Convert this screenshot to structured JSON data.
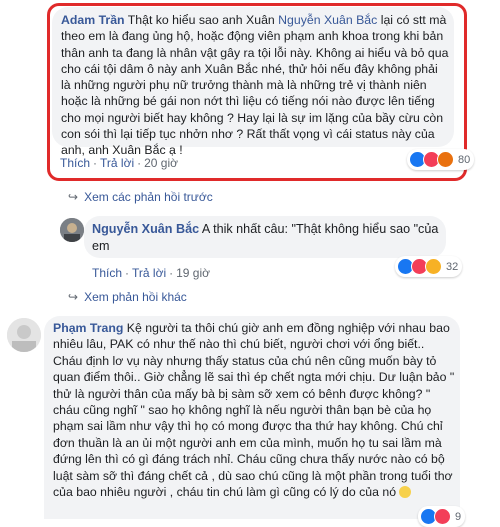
{
  "comment1": {
    "author": "Adam Trần",
    "text_before": " Thật ko hiểu sao anh Xuân ",
    "mention": "Nguyễn Xuân Bắc",
    "text_after": " lại có stt mà theo em là đang ủng hộ, hoặc động viên phạm anh khoa trong khi bản thân anh ta đang là nhân vật gây ra tội lỗi này. Không ai hiểu và bỏ qua cho cái tội dâm ô này anh Xuân Bắc nhé, thử hỏi nếu đây không phải là những người phụ nữ trưởng thành mà là những trẻ vị thành niên hoặc là những bé gái non nớt thì liệu có tiếng nói nào được lên tiếng cho mọi người biết hay không ? Hay lại là sự im lặng của bầy cừu còn con sói thì lại tiếp tục nhởn nhơ ? Rất thất vọng vì cái status này của anh, anh Xuân Bắc ạ !",
    "like": "Thích",
    "reply": "Trả lời",
    "time": "20 giờ",
    "reaction_count": "80"
  },
  "view_previous_replies": "Xem các phản hồi trước",
  "reply1": {
    "author": "Nguyễn Xuân Bắc",
    "text": " A thik nhất câu: \"Thật không hiểu sao \"của em",
    "like": "Thích",
    "reply": "Trả lời",
    "time": "19 giờ",
    "reaction_count": "32"
  },
  "view_more_replies": "Xem phản hồi khác",
  "comment2": {
    "author": "Phạm Trang",
    "text": " Kệ người ta thôi chú giờ anh em đồng nghiệp với nhau bao nhiêu lâu, PAK có như thế nào thì chú biết, người chơi với ổng biết.. Cháu định lơ vụ này nhưng thấy status của chú nên cũng muốn bày tỏ quan điểm thôi.. Giờ chẳng lẽ sai thì ép chết ngta mới chịu. Dư luận bảo \" thử là người thân của mấy bà bị sàm sỡ xem có bênh được không? \" cháu cũng nghĩ \" sao họ không nghĩ là nếu người thân bạn bè của họ phạm sai lầm như vậy thì họ có mong được tha thứ hay không. Chú chỉ đơn thuần là an ủi một người anh em của mình, muốn họ tu sai lầm mà đứng lên thì có gì đáng trách nhỉ. Cháu cũng chưa thấy nước nào có bộ luật sàm sỡ thì đáng chết cả , dù sao chú cũng là một phần trong tuổi thơ của bao nhiêu người , cháu tin chú làm gì cũng có lý do của nó ",
    "reaction_count": "9"
  },
  "colors": {
    "link_blue": "#385898",
    "bubble_gray": "#f2f3f5",
    "highlight_red": "#e02a2a"
  },
  "icons": [
    "reply-arrow-icon",
    "like-reaction-icon",
    "love-reaction-icon",
    "sad-reaction-icon",
    "angry-reaction-icon",
    "smile-emoji-icon"
  ]
}
